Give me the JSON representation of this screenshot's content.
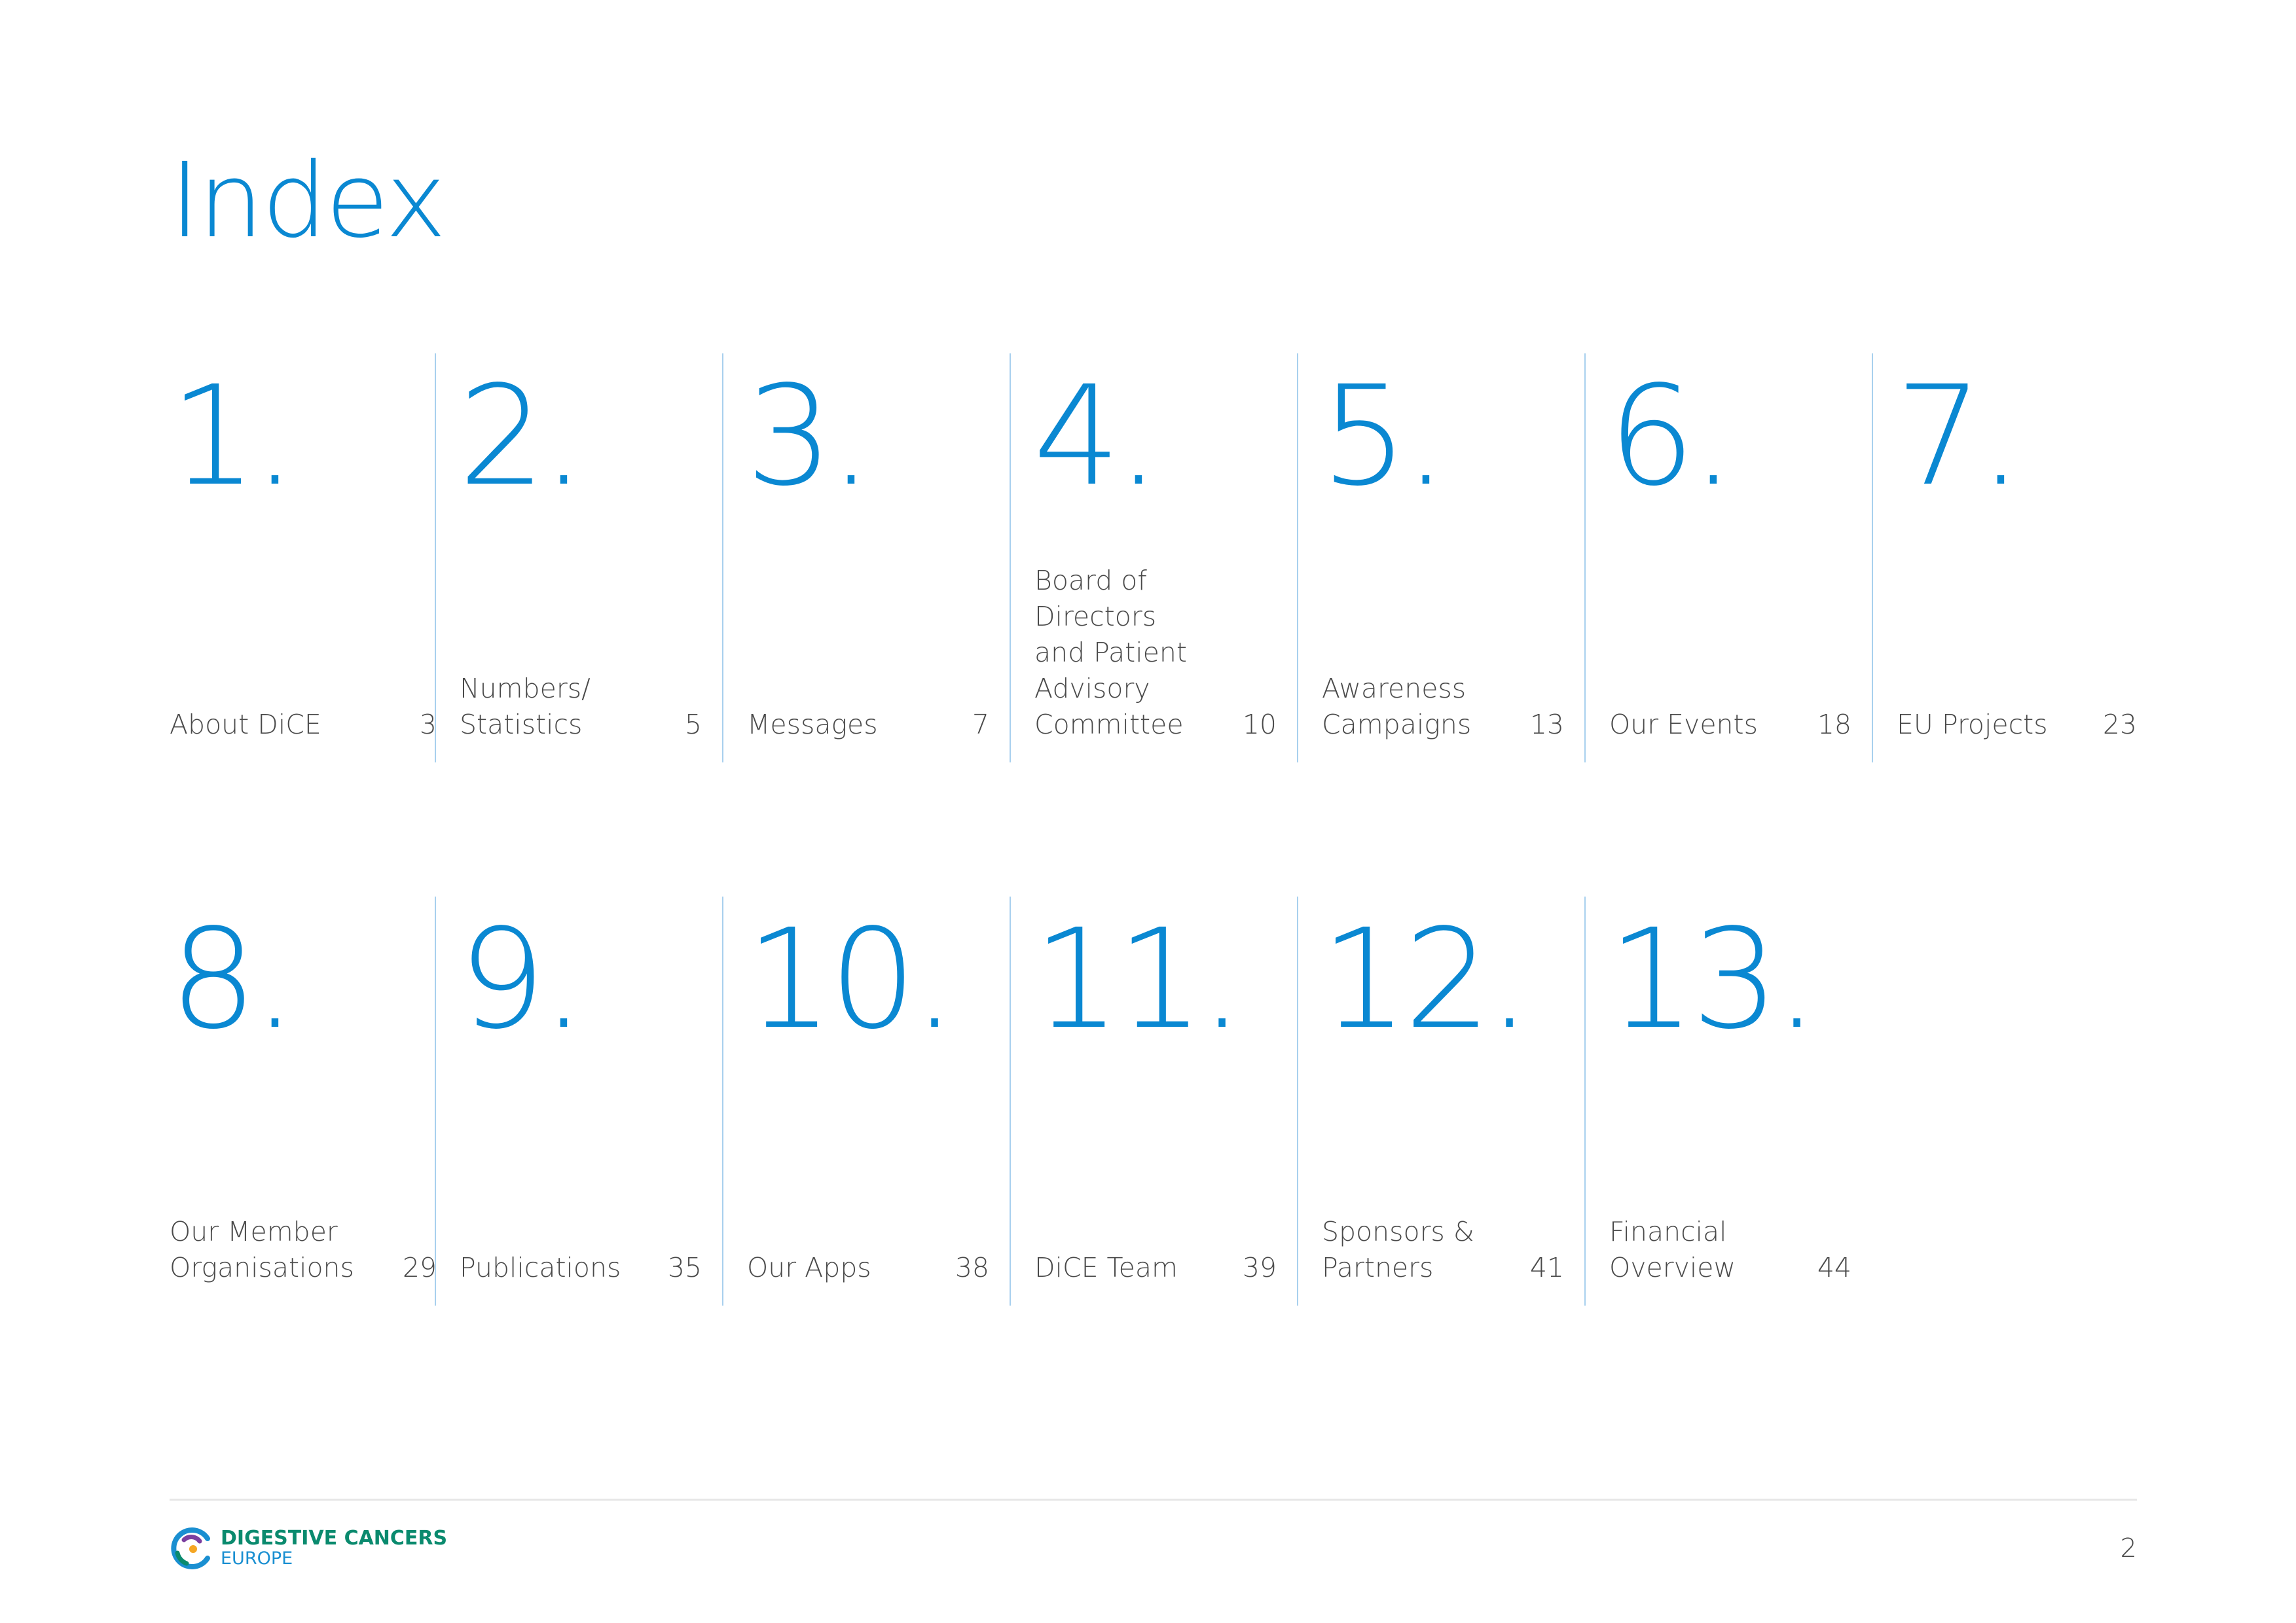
{
  "page_title": "Index",
  "row1": [
    {
      "number": "1.",
      "label": "About DiCE",
      "page": "3"
    },
    {
      "number": "2.",
      "label": "Numbers/ Statistics",
      "page": "5"
    },
    {
      "number": "3.",
      "label": "Messages",
      "page": "7"
    },
    {
      "number": "4.",
      "label": "Board of Directors and Patient Advisory Committee",
      "page": "10"
    },
    {
      "number": "5.",
      "label": "Awareness Campaigns",
      "page": "13"
    },
    {
      "number": "6.",
      "label": "Our Events",
      "page": "18"
    },
    {
      "number": "7.",
      "label": "EU Projects",
      "page": "23"
    }
  ],
  "row2": [
    {
      "number": "8.",
      "label": "Our Member Organisations",
      "page": "29"
    },
    {
      "number": "9.",
      "label": "Publications",
      "page": "35"
    },
    {
      "number": "10.",
      "label": "Our Apps",
      "page": "38"
    },
    {
      "number": "11.",
      "label": "DiCE Team",
      "page": "39"
    },
    {
      "number": "12.",
      "label": "Sponsors & Partners",
      "page": "41"
    },
    {
      "number": "13.",
      "label": "Financial Overview",
      "page": "44"
    }
  ],
  "footer": {
    "logo_line1": "DIGESTIVE CANCERS",
    "logo_line2": "EUROPE",
    "page_number": "2"
  },
  "colors": {
    "accent_blue": "#0a88d2",
    "divider_blue": "#a8d0ee",
    "logo_green": "#0a8a6e",
    "text_gray": "#4a4a4a"
  }
}
